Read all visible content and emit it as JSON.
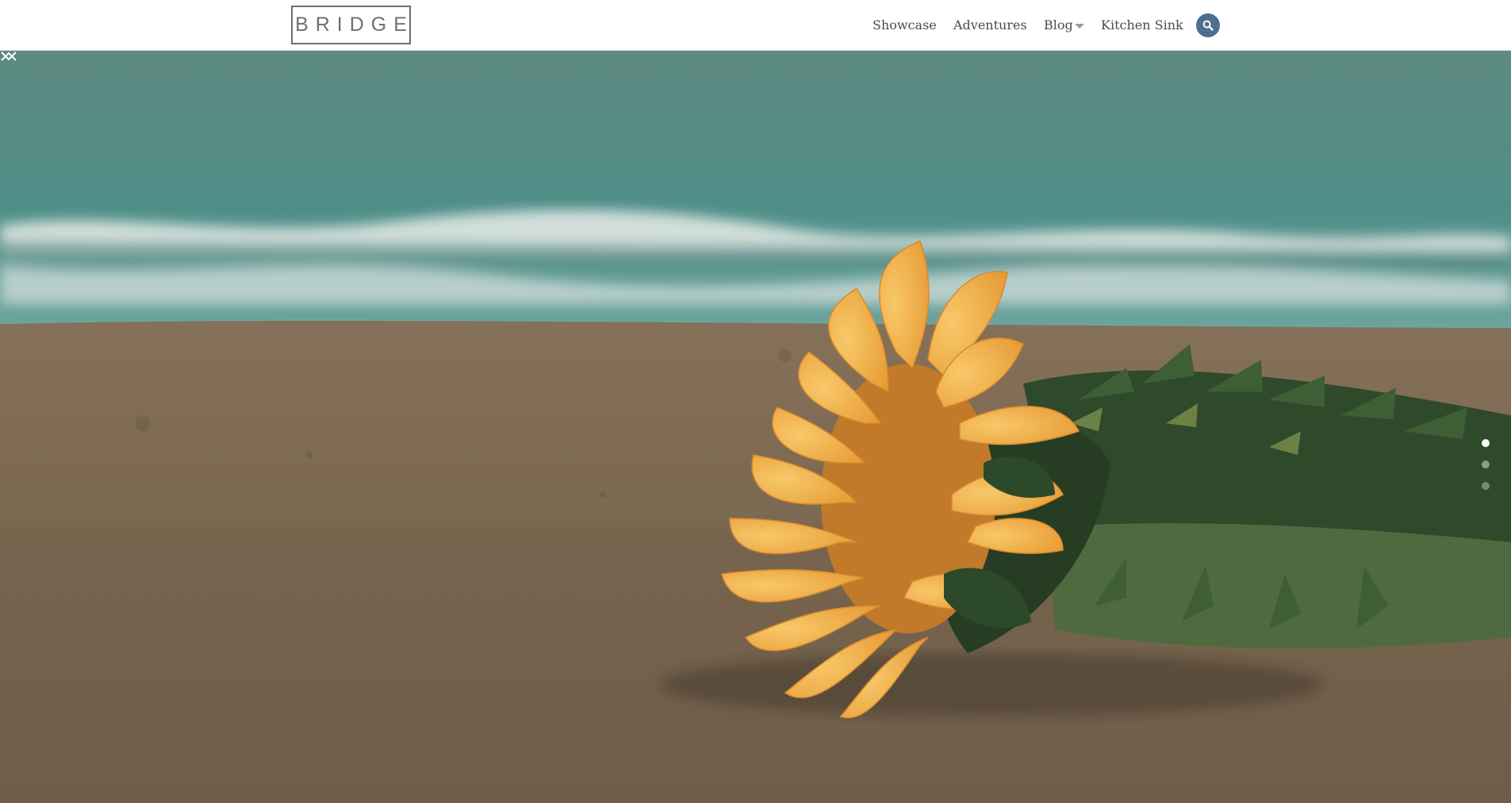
{
  "header": {
    "logo_text": "BRIDGE",
    "nav": [
      {
        "label": "Showcase"
      },
      {
        "label": "Adventures"
      },
      {
        "label": "Blog",
        "has_dropdown": true
      },
      {
        "label": "Kitchen Sink"
      }
    ],
    "search_icon": "search-icon",
    "search_button_color": "#4c6e91"
  },
  "slider": {
    "image": "sunflower lying on beach sand with sea waves behind",
    "prev_icon": "chevron-up-icon",
    "next_icon": "chevron-down-icon",
    "slide_count": 3,
    "active_slide": 1
  },
  "colors": {
    "sea": "#5a8d86",
    "sand": "#7d6a54",
    "petal": "#f2b24a",
    "leaf": "#2f4a2c"
  }
}
